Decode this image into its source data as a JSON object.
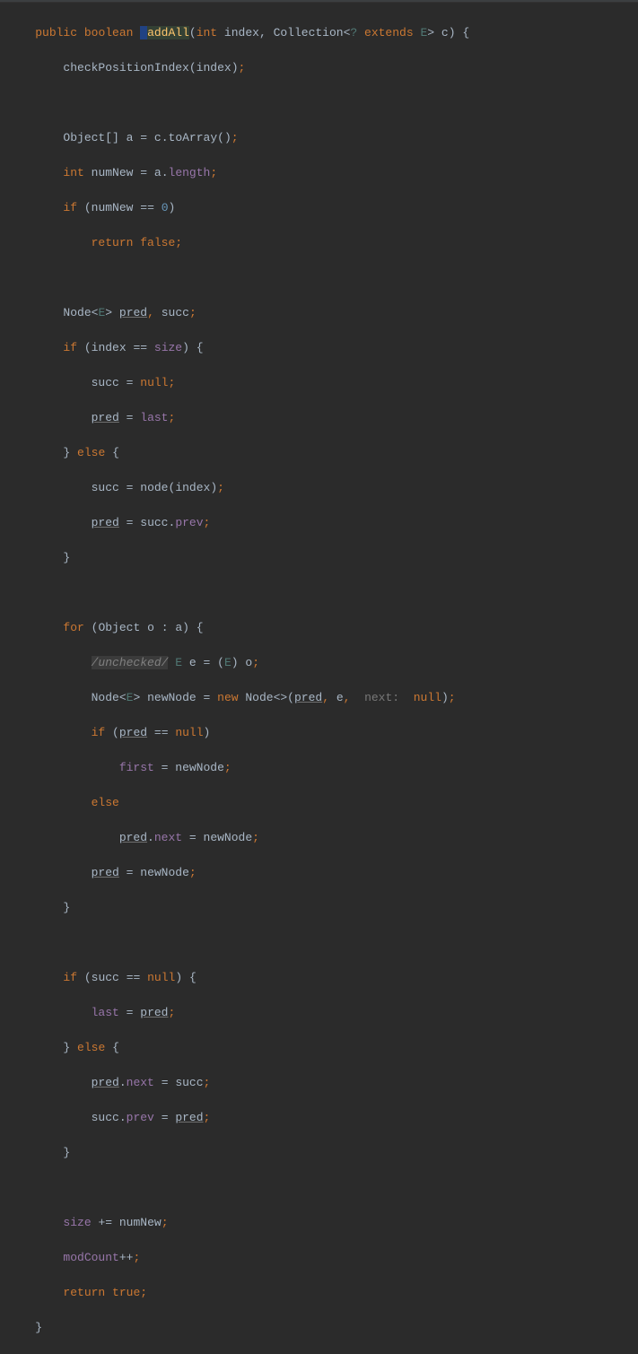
{
  "tokens": {
    "kw_public": "public",
    "kw_boolean": "boolean",
    "method_name": "addAll",
    "kw_int": "int",
    "param_index": "index",
    "type_collection": "Collection",
    "generic_wild": "?",
    "kw_extends": "extends",
    "generic_e": "E",
    "param_c": "c",
    "call_checkPositionIndex": "checkPositionIndex",
    "type_object": "Object",
    "brackets": "[]",
    "var_a": "a",
    "call_toArray": "toArray",
    "var_numNew": "numNew",
    "field_length": "length",
    "kw_if": "if",
    "op_eqeq": "==",
    "lit_zero": "0",
    "kw_return": "return",
    "kw_false": "false",
    "type_node": "Node",
    "var_pred": "pred",
    "var_succ": "succ",
    "field_size": "size",
    "kw_null": "null",
    "field_last": "last",
    "kw_else": "else",
    "call_node": "node",
    "field_prev": "prev",
    "kw_for": "for",
    "var_o": "o",
    "comment_unchecked": "/unchecked/",
    "var_e": "e",
    "var_newNode": "newNode",
    "kw_new": "new",
    "hint_next": "next:",
    "field_first": "first",
    "field_next": "next",
    "field_modCount": "modCount",
    "kw_true": "true",
    "op_pluseq": "+=",
    "op_plusplus": "++"
  }
}
